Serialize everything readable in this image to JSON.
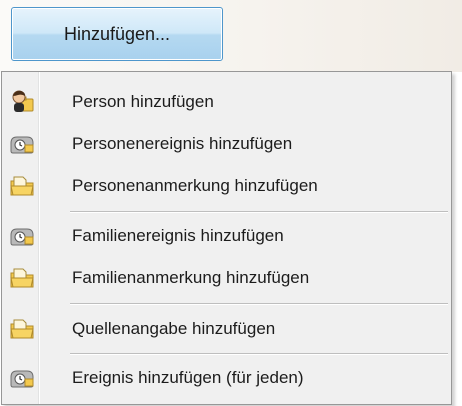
{
  "button": {
    "label": "Hinzufügen..."
  },
  "menu": {
    "items": [
      {
        "label": "Person hinzufügen",
        "icon": "person-icon"
      },
      {
        "label": "Personenereignis hinzufügen",
        "icon": "event-icon"
      },
      {
        "label": "Personenanmerkung hinzufügen",
        "icon": "note-folder-icon"
      },
      {
        "label": "Familienereignis hinzufügen",
        "icon": "event-icon"
      },
      {
        "label": "Familienanmerkung hinzufügen",
        "icon": "note-folder-icon"
      },
      {
        "label": "Quellenangabe hinzufügen",
        "icon": "note-folder-icon"
      },
      {
        "label": "Ereignis hinzufügen (für jeden)",
        "icon": "event-icon"
      }
    ]
  },
  "colors": {
    "button_border": "#4e96cb",
    "menu_bg": "#f0f0f0",
    "folder_yellow": "#f3c94e"
  }
}
